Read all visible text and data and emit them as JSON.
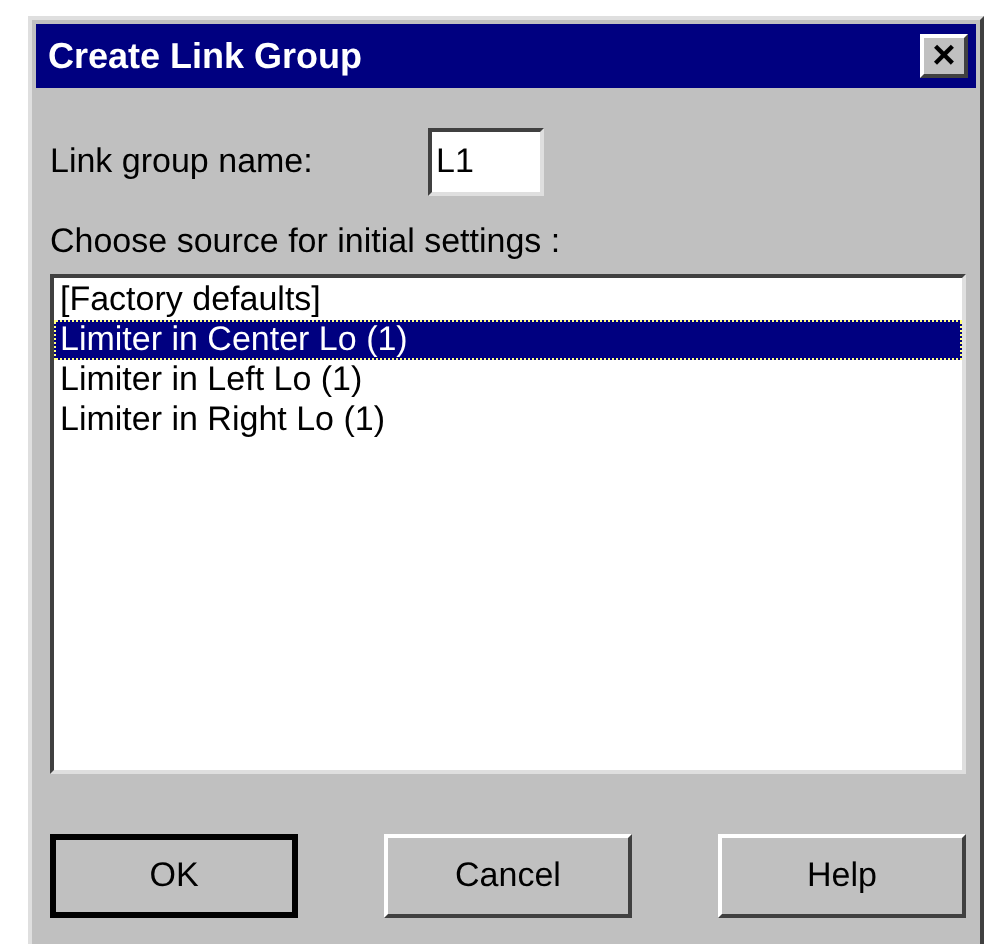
{
  "window": {
    "title": "Create Link Group",
    "close": "×"
  },
  "name_field": {
    "label": "Link group name:",
    "value": "L1"
  },
  "source": {
    "label": "Choose source for initial settings :",
    "items": [
      {
        "label": "[Factory defaults]",
        "selected": false
      },
      {
        "label": "Limiter in Center Lo (1)",
        "selected": true
      },
      {
        "label": "Limiter in Left Lo (1)",
        "selected": false
      },
      {
        "label": "Limiter in Right Lo (1)",
        "selected": false
      }
    ]
  },
  "buttons": [
    {
      "label": "OK",
      "default": true
    },
    {
      "label": "Cancel",
      "default": false
    },
    {
      "label": "Help",
      "default": false
    }
  ]
}
